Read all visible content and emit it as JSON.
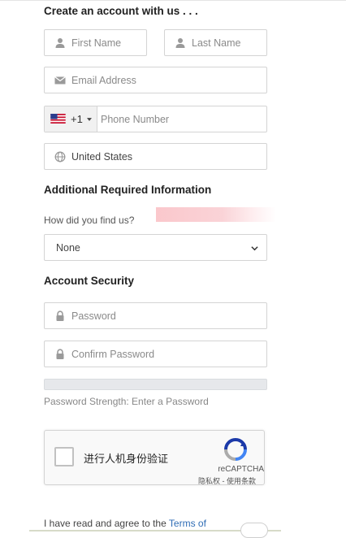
{
  "sections": {
    "create_account": "Create an account with us . . .",
    "additional": "Additional Required Information",
    "security": "Account Security"
  },
  "fields": {
    "first_name": {
      "placeholder": "First Name",
      "icon": "user-icon"
    },
    "last_name": {
      "placeholder": "Last Name",
      "icon": "user-icon"
    },
    "email": {
      "placeholder": "Email Address",
      "icon": "envelope-icon"
    },
    "phone": {
      "country_code": "+1",
      "placeholder": "Phone Number",
      "flag": "us-flag-icon"
    },
    "country": {
      "value": "United States",
      "icon": "globe-icon"
    },
    "password": {
      "placeholder": "Password",
      "icon": "lock-icon"
    },
    "confirm_password": {
      "placeholder": "Confirm Password",
      "icon": "lock-icon"
    }
  },
  "referral": {
    "question": "How did you find us?",
    "selected": "None"
  },
  "password_strength": {
    "text": "Password Strength: Enter a Password",
    "level": 0
  },
  "captcha": {
    "label": "进行人机身份验证",
    "brand": "reCAPTCHA",
    "links": "隐私权 - 使用条款"
  },
  "terms": {
    "text": "I have read and agree to the ",
    "link": "Terms of"
  },
  "colors": {
    "link": "#2f6db5",
    "border": "#d4d4d4",
    "placeholder": "#8a8a8a"
  }
}
